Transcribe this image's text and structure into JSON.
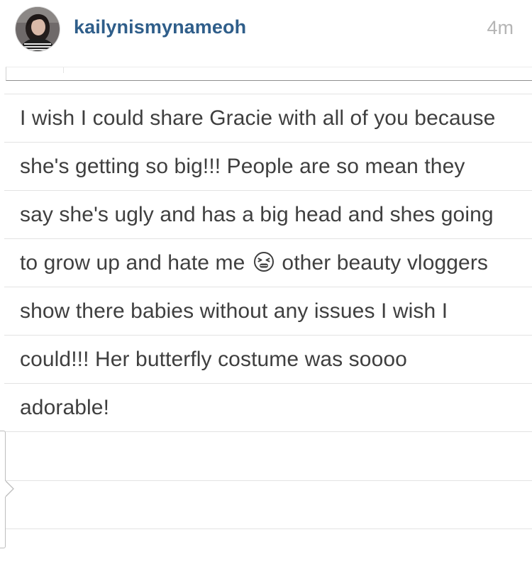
{
  "post": {
    "username": "kailynismynameoh",
    "timestamp": "4m",
    "avatar_icon": "profile-photo"
  },
  "caption": {
    "lines": [
      "I wish I could share Gracie with all of you because",
      "she's getting so big!!! People are so mean they",
      "say she's ugly and has a big head and shes going",
      "to grow up and hate me",
      "other beauty vloggers",
      "show there babies without any issues I wish I",
      "could!!! Her butterfly costume was soooo",
      "adorable!"
    ],
    "emoji_icon": "tired-face-emoji-icon"
  },
  "colors": {
    "username": "#2f5e8a",
    "timestamp": "#b5b5b5",
    "text": "#3f3f3f",
    "rule": "#e3e3e3"
  }
}
